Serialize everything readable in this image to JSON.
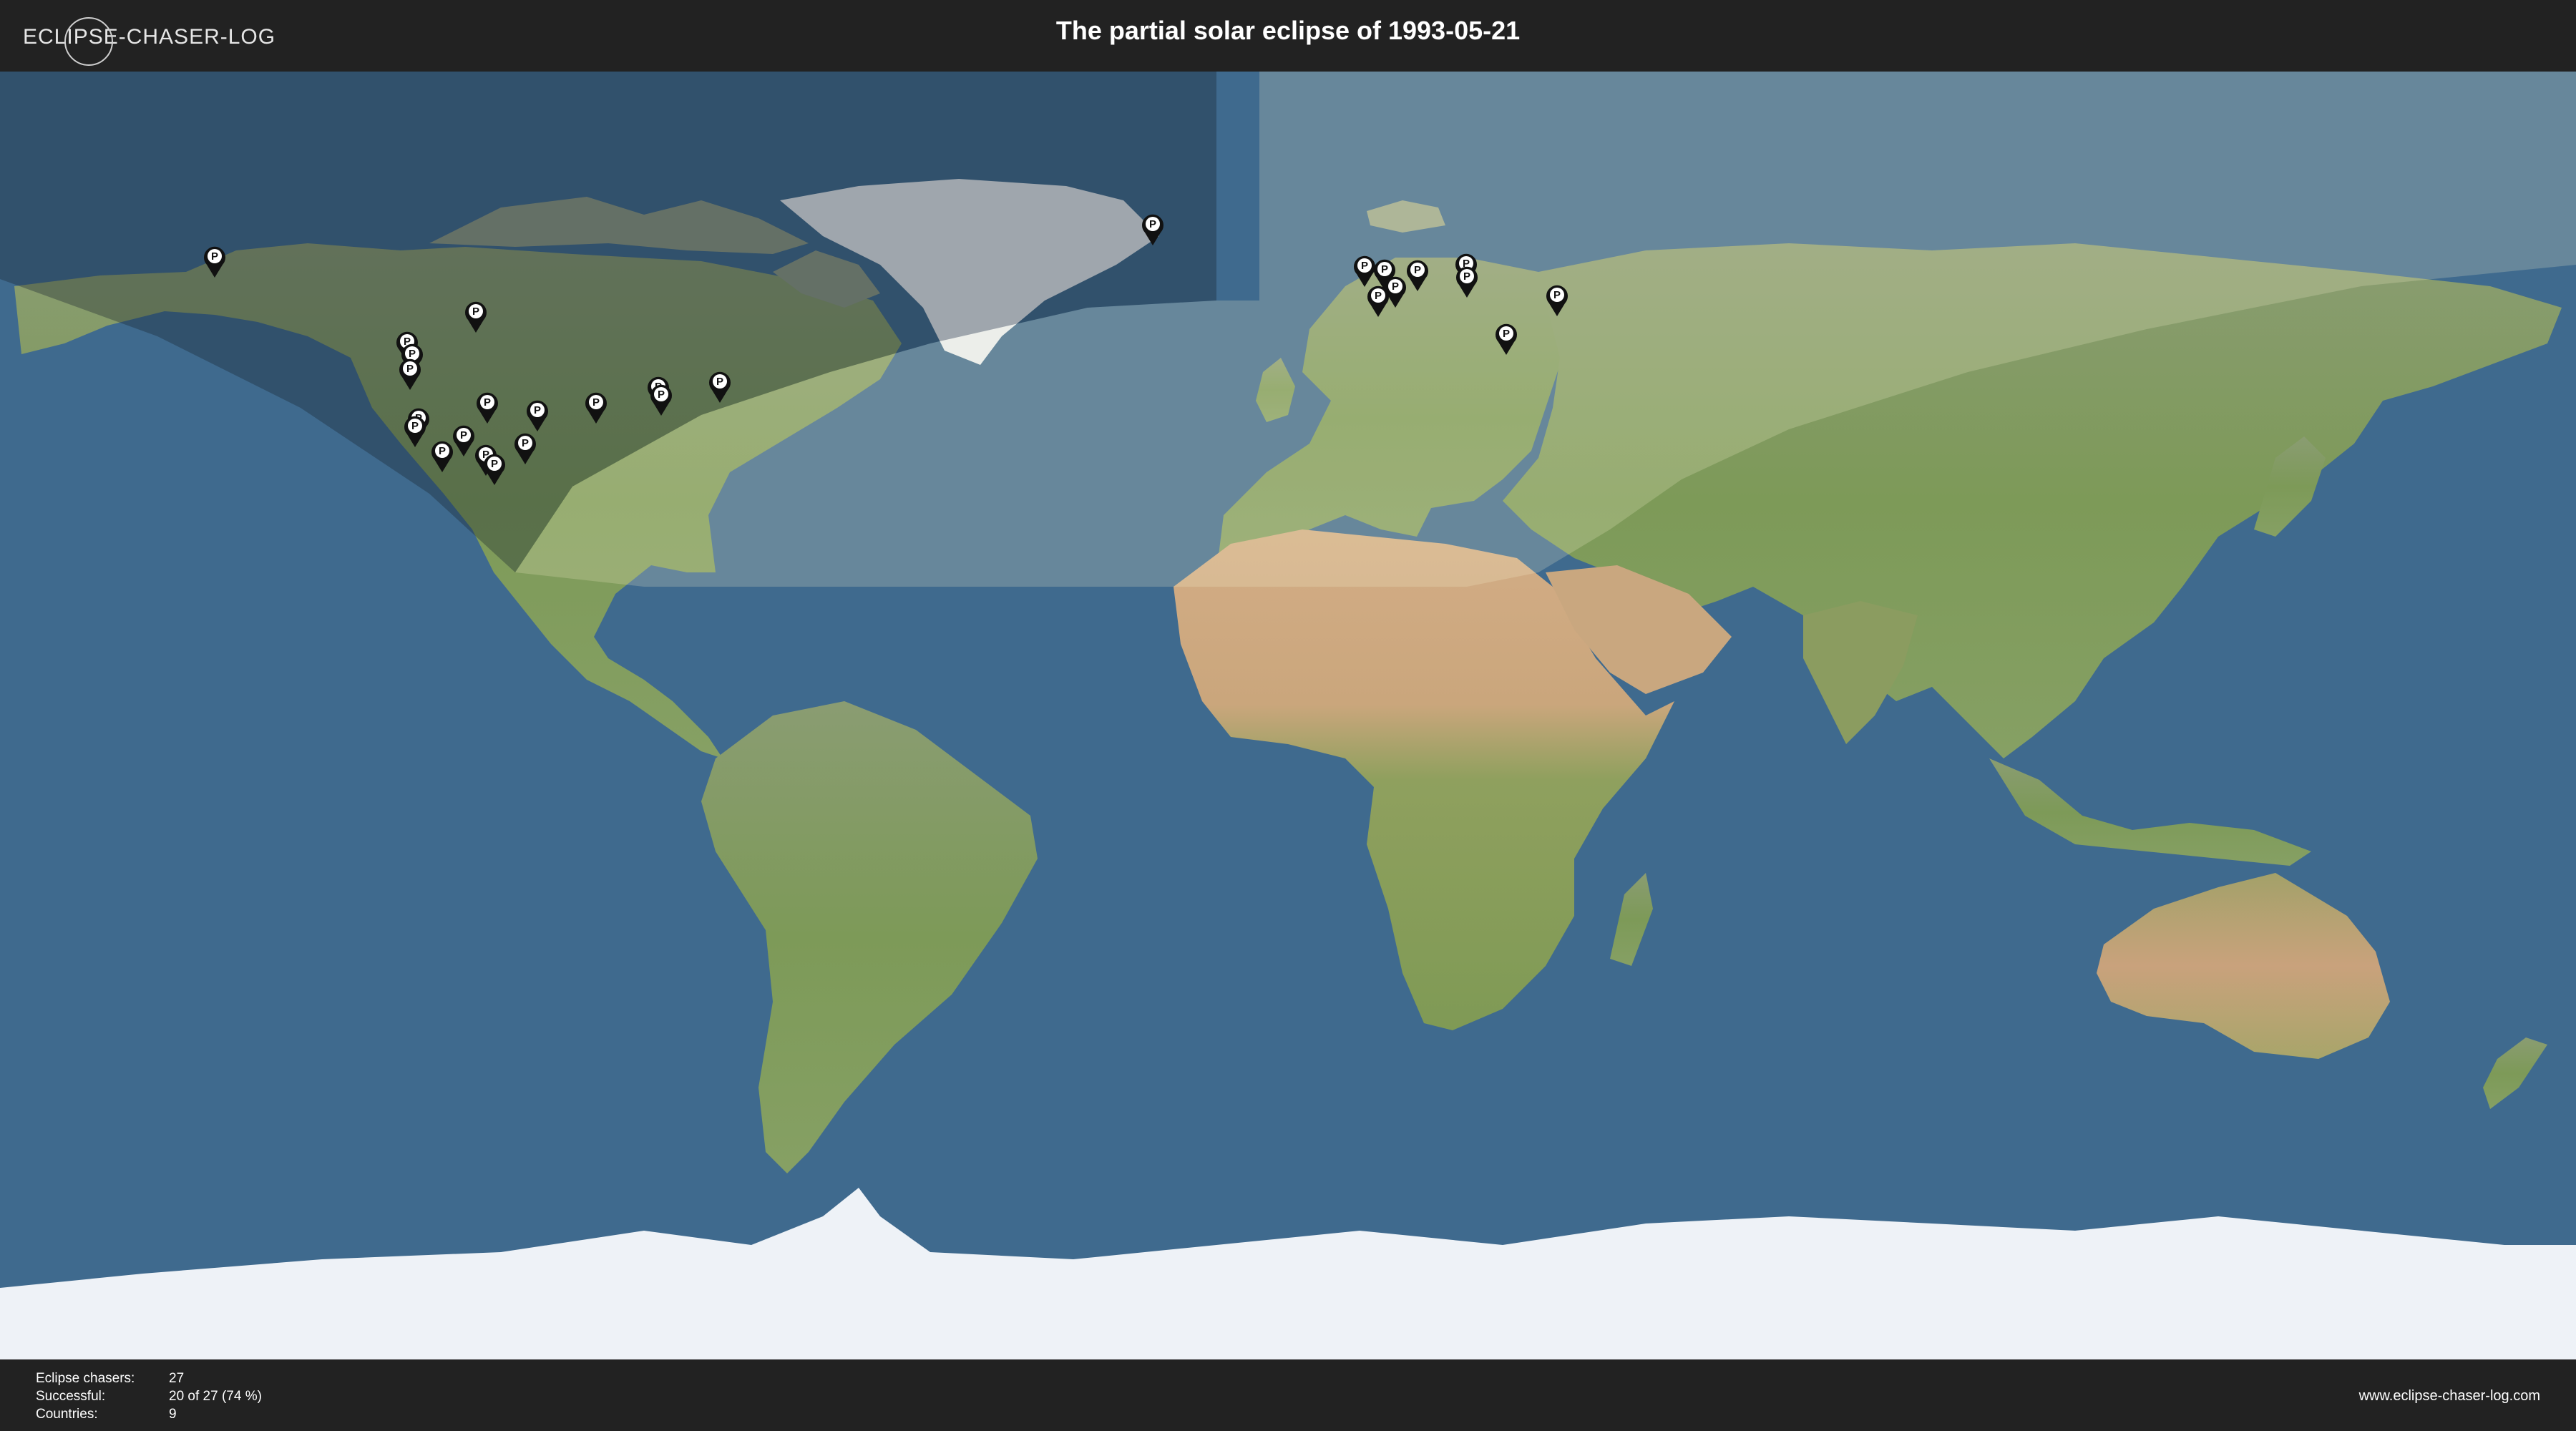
{
  "header": {
    "logo_text": "ECLIPSE-CHASER-LOG",
    "title": "The partial solar eclipse of 1993-05-21"
  },
  "footer": {
    "stats": [
      {
        "label": "Eclipse chasers:",
        "value": "27"
      },
      {
        "label": "Successful:",
        "value": "20 of 27 (74 %)"
      },
      {
        "label": "Countries:",
        "value": "9"
      }
    ],
    "website": "www.eclipse-chaser-log.com"
  },
  "map": {
    "projection": "equirectangular",
    "colors": {
      "ocean": "#3f6a8e",
      "land": "#7e9a5c",
      "desert": "#c9a77f",
      "ice": "#e8edf3",
      "eclipse_shadow_day": "#f3f0d0",
      "eclipse_shadow_night": "#1e2a38",
      "pin": "#111111",
      "pin_badge": "#ffffff"
    },
    "pin_label": "P",
    "pins": [
      {
        "lon": -150.0,
        "lat": 61.2
      },
      {
        "lon": -113.5,
        "lat": 53.5
      },
      {
        "lon": -123.1,
        "lat": 49.3
      },
      {
        "lon": -122.4,
        "lat": 47.6
      },
      {
        "lon": -122.7,
        "lat": 45.5
      },
      {
        "lon": -121.5,
        "lat": 38.6
      },
      {
        "lon": -122.0,
        "lat": 37.5
      },
      {
        "lon": -118.2,
        "lat": 34.0
      },
      {
        "lon": -111.9,
        "lat": 40.8
      },
      {
        "lon": -115.2,
        "lat": 36.2
      },
      {
        "lon": -112.1,
        "lat": 33.5
      },
      {
        "lon": -110.9,
        "lat": 32.2
      },
      {
        "lon": -104.9,
        "lat": 39.7
      },
      {
        "lon": -106.6,
        "lat": 35.1
      },
      {
        "lon": -96.7,
        "lat": 40.8
      },
      {
        "lon": -88.0,
        "lat": 43.0
      },
      {
        "lon": -87.6,
        "lat": 41.9
      },
      {
        "lon": -79.4,
        "lat": 43.7
      },
      {
        "lon": -18.9,
        "lat": 65.7
      },
      {
        "lon": 10.7,
        "lat": 59.9
      },
      {
        "lon": 13.5,
        "lat": 59.4
      },
      {
        "lon": 18.1,
        "lat": 59.3
      },
      {
        "lon": 24.9,
        "lat": 60.2
      },
      {
        "lon": 25.0,
        "lat": 58.4
      },
      {
        "lon": 15.0,
        "lat": 57.0
      },
      {
        "lon": 12.6,
        "lat": 55.7
      },
      {
        "lon": 37.6,
        "lat": 55.8
      },
      {
        "lon": 30.5,
        "lat": 50.4
      }
    ]
  }
}
